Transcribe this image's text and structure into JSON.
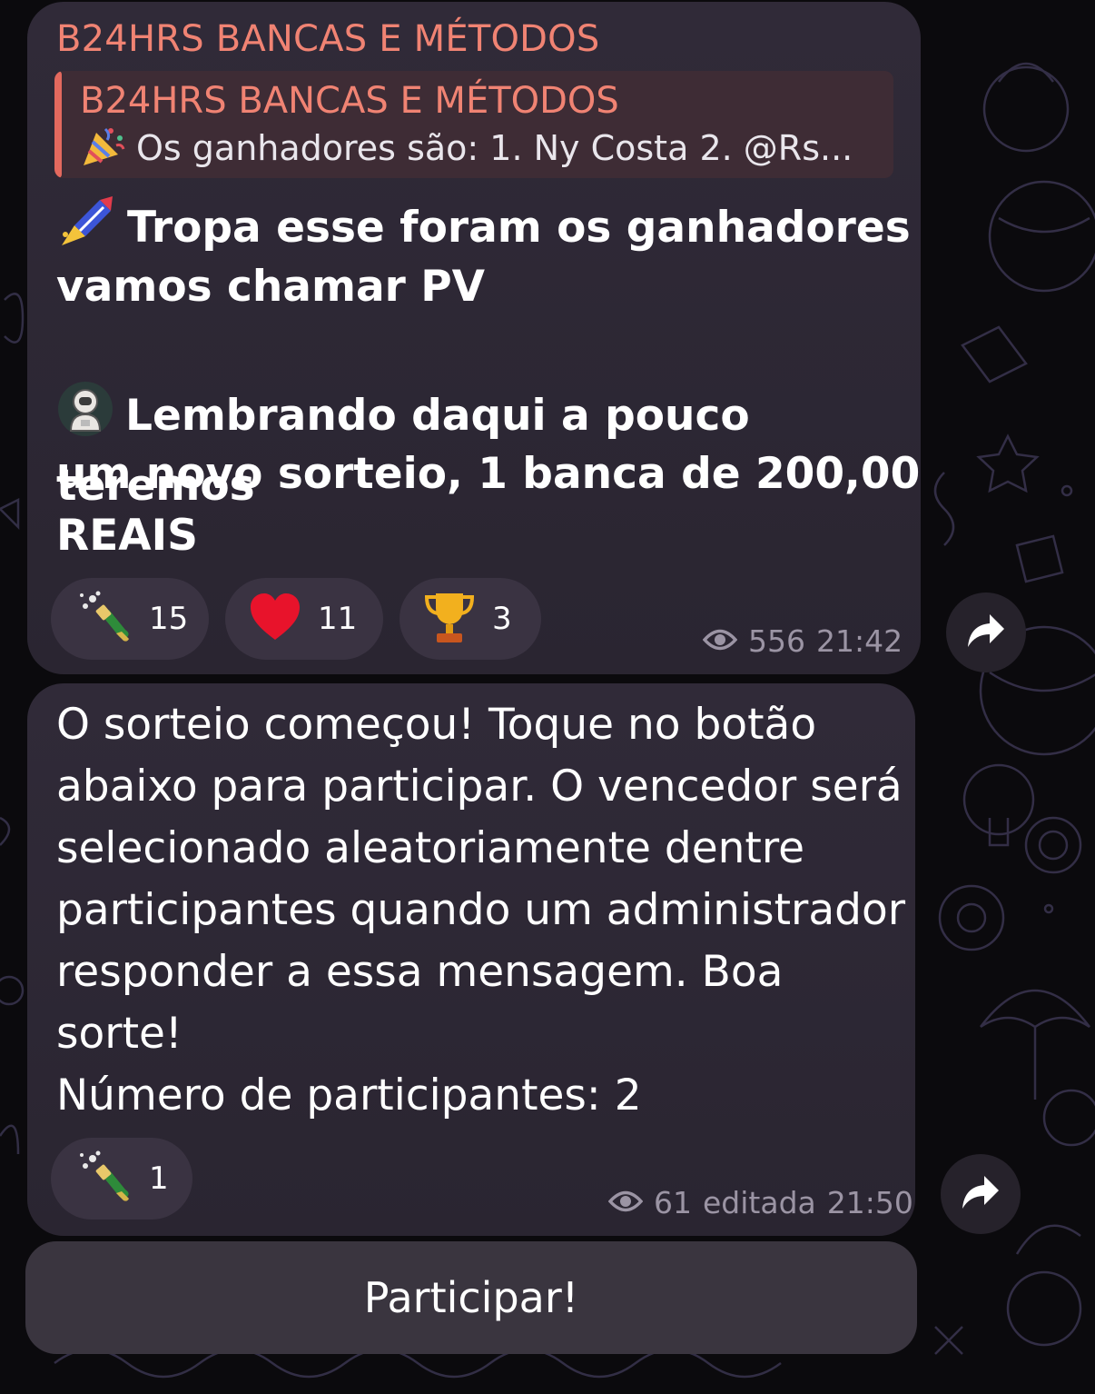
{
  "message_1": {
    "sender": "B24HRS BANCAS E MÉTODOS",
    "reply": {
      "title": "B24HRS BANCAS E MÉTODOS",
      "text": "Os ganhadores são: 1. Ny Costa 2. @Rs...",
      "icon": "party-popper-icon"
    },
    "line1_icon": "firework-rocket-icon",
    "line1": "Tropa esse foram os ganhadores",
    "line2": "vamos chamar PV",
    "line3_icon": "astronaut-icon",
    "line3": "Lembrando daqui a pouco teremos",
    "line4": "um novo sorteio, 1 banca de 200,00",
    "line5": "REAIS",
    "reactions": [
      {
        "icon": "champagne-icon",
        "count": "15"
      },
      {
        "icon": "red-heart-icon",
        "count": "11"
      },
      {
        "icon": "trophy-icon",
        "count": "3"
      }
    ],
    "views": "556",
    "time": "21:42"
  },
  "message_2": {
    "line1": "O sorteio começou! Toque no botão",
    "line2": "abaixo para participar. O vencedor será",
    "line3": "selecionado aleatoriamente dentre",
    "line4": "participantes quando um administrador",
    "line5": "responder a essa mensagem. Boa sorte!",
    "participants": "Número de participantes: 2",
    "reactions": [
      {
        "icon": "champagne-icon",
        "count": "1"
      }
    ],
    "views": "61",
    "edited": "editada",
    "time": "21:50"
  },
  "inline_button": {
    "label": "Participar!"
  },
  "colors": {
    "accent": "#f08373",
    "bubble": "#2d2834",
    "reaction_bg": "#3a3342",
    "meta": "#9b94a4"
  }
}
